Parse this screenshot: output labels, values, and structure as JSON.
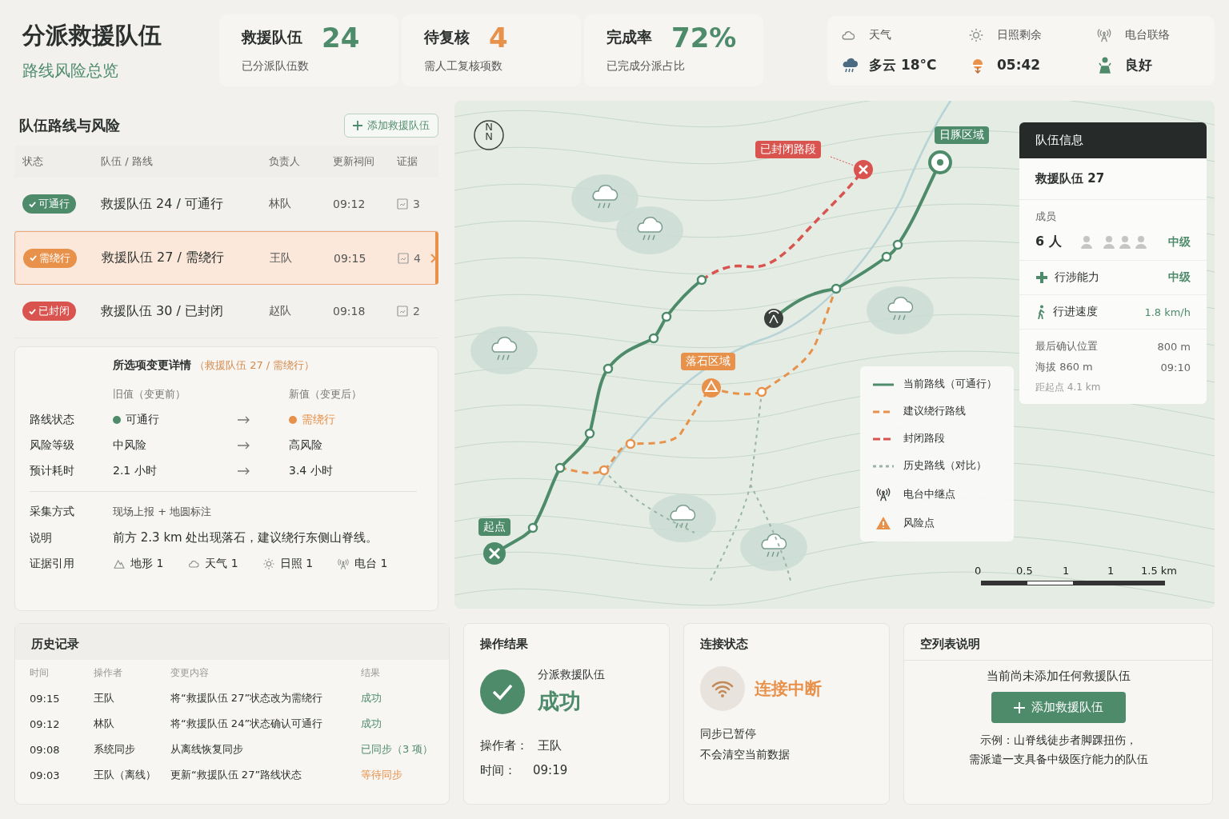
{
  "header": {
    "title": "分派救援队伍",
    "subtitle": "路线风险总览"
  },
  "stats": [
    {
      "label": "救援队伍",
      "value": "24",
      "caption": "已分派队伍数",
      "color": "#4e8b6a"
    },
    {
      "label": "待复核",
      "value": "4",
      "caption": "需人工复核项数",
      "color": "#e8914a"
    },
    {
      "label": "完成率",
      "value": "72%",
      "caption": "已完成分派占比",
      "color": "#4e8b6a"
    }
  ],
  "conditions": [
    {
      "kind": "weather",
      "label": "天气",
      "value": "多云 18°C"
    },
    {
      "kind": "sun",
      "label": "日照剩余",
      "value": "05:42"
    },
    {
      "kind": "radio",
      "label": "电台联络",
      "value": "良好"
    }
  ],
  "routes": {
    "title": "队伍路线与风险",
    "add_button": "添加救援队伍",
    "columns": [
      "状态",
      "队伍 / 路线",
      "负责人",
      "更新祠间",
      "证据"
    ],
    "rows": [
      {
        "status": "可通行",
        "kind": "ok",
        "team_route": "救援队伍 24 / 可通行",
        "owner": "林队",
        "time": "09:12",
        "evidence": "3",
        "selected": false
      },
      {
        "status": "需绕行",
        "kind": "detour",
        "team_route": "救援队伍 27 / 需绕行",
        "owner": "王队",
        "time": "09:15",
        "evidence": "4",
        "selected": true
      },
      {
        "status": "已封闭",
        "kind": "closed",
        "team_route": "救援队伍 30 / 已封闭",
        "owner": "赵队",
        "time": "09:18",
        "evidence": "2",
        "selected": false
      }
    ]
  },
  "details": {
    "title": "所选项变更详情",
    "subtitle": "（救援队伍 27 / 需绕行）",
    "old_header": "旧值（变更前）",
    "new_header": "新值（变更后）",
    "changes": [
      {
        "label": "路线状态",
        "old": "可通行",
        "new": "需绕行",
        "old_dot": {
          "color": "#4e8b6a"
        },
        "new_dot": {
          "color": "#e8914a"
        }
      },
      {
        "label": "风险等级",
        "old": "中风险",
        "new": "高风险"
      },
      {
        "label": "预计耗时",
        "old": "2.1 小时",
        "new": "3.4 小时"
      }
    ],
    "info": [
      {
        "label": "采集方式",
        "value": "现场上报 + 地圆标注"
      },
      {
        "label": "说明",
        "value": "前方 2.3 km 处出现落石，建议绕行东侧山脊线。"
      }
    ],
    "evidence_label": "证据引用",
    "evidence": [
      {
        "kind": "terrain",
        "text": "地形 1"
      },
      {
        "kind": "weather",
        "text": "天气 1"
      },
      {
        "kind": "sun",
        "text": "日照 1"
      },
      {
        "kind": "radio",
        "text": "电台 1"
      }
    ]
  },
  "map": {
    "compass": [
      "N",
      "N"
    ],
    "labels": [
      {
        "kind": "closed",
        "text": "已封闭路段"
      },
      {
        "kind": "destination",
        "text": "日豚区域"
      },
      {
        "kind": "risk",
        "text": "落石区域"
      },
      {
        "kind": "start",
        "text": "起点"
      }
    ],
    "legend": [
      {
        "kind": "current",
        "text": "当前路线（可通行）"
      },
      {
        "kind": "detour",
        "text": "建议绕行路线"
      },
      {
        "kind": "closed",
        "text": "封闭路段"
      },
      {
        "kind": "history",
        "text": "历史路线（对比）"
      },
      {
        "kind": "radio",
        "text": "电台中继点"
      },
      {
        "kind": "risk",
        "text": "风险点"
      }
    ],
    "scale": [
      "0",
      "0.5",
      "1",
      "1",
      "1.5 km"
    ]
  },
  "team_info": {
    "title": "队伍信息",
    "team": "救援队伍 27",
    "members_label": "成员",
    "members": "6 人",
    "members_level": "中级",
    "skills": [
      {
        "kind": "medical",
        "label": "行涉能力",
        "value": "中级"
      },
      {
        "kind": "walk",
        "label": "行进速度",
        "value": "1.8 km/h"
      }
    ],
    "position_label": "最后确认位置",
    "position_value": "800 m",
    "altitude": "海拔 860 m",
    "confirmed_time": "09:10",
    "distance": "距起点 4.1 km"
  },
  "history": {
    "title": "历史记录",
    "columns": [
      "时间",
      "操作者",
      "变更内容",
      "结果"
    ],
    "rows": [
      {
        "time": "09:15",
        "operator": "王队",
        "change": "将“救援队伍 27”状态改为需绕行",
        "result": "成功",
        "kind": "done"
      },
      {
        "time": "09:12",
        "operator": "林队",
        "change": "将“救援队伍 24”状态确认可通行",
        "result": "成功",
        "kind": "done"
      },
      {
        "time": "09:08",
        "operator": "系统同步",
        "change": "从离线恢复同步",
        "result": "已同步（3 项）",
        "kind": "done"
      },
      {
        "time": "09:03",
        "operator": "王队（离线）",
        "change": "更新“救援队伍 27”路线状态",
        "result": "等待同步",
        "kind": "pending"
      }
    ]
  },
  "result": {
    "title": "操作结果",
    "action": "分派救援队伍",
    "outcome": "成功",
    "operator_label": "操作者：",
    "operator": "王队",
    "time_label": "时间：",
    "time": "09:19"
  },
  "connection": {
    "title": "连接状态",
    "status": "连接中断",
    "lines": [
      "同步已暂停",
      "不会清空当前数据"
    ]
  },
  "empty": {
    "title": "空列表说明",
    "message": "当前尚未添加任何救援队伍",
    "button": "添加救援队伍",
    "example": [
      "示例：山脊线徒步者脚踝扭伤，",
      "需派遣一支具备中级医疗能力的队伍"
    ]
  }
}
